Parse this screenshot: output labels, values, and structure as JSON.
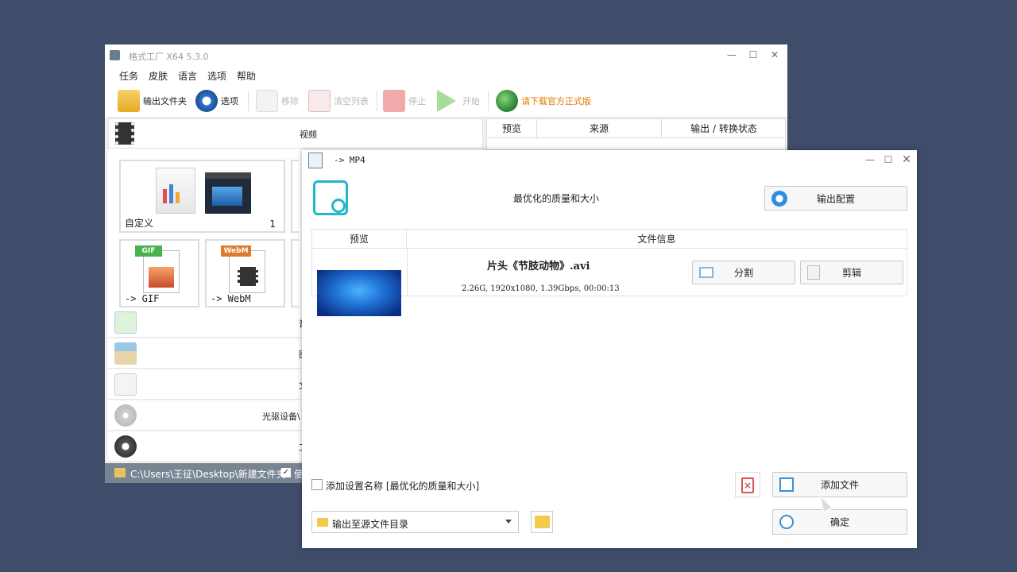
{
  "main_window": {
    "title": "格式工厂 X64 5.3.0",
    "controls": {
      "minimize": "—",
      "maximize": "☐",
      "close": "✕"
    },
    "menu": [
      "任务",
      "皮肤",
      "语言",
      "选项",
      "帮助"
    ],
    "toolbar": {
      "output_folder": "输出文件夹",
      "options": "选项",
      "remove": "移除",
      "clear_list": "清空列表",
      "stop": "停止",
      "start": "开始",
      "download": "请下载官方正式版"
    },
    "category_video": "视频",
    "tiles": [
      {
        "label": "自定义",
        "count": "1"
      },
      {
        "label": "-> GIF"
      },
      {
        "label": "-> WebM"
      }
    ],
    "tile_badges": {
      "gif": "GIF",
      "webm": "WebM"
    },
    "categories": [
      "音",
      "图",
      "文",
      "光驱设备\\",
      "工"
    ],
    "task_table_headers": [
      "预览",
      "来源",
      "输出 / 转换状态"
    ],
    "statusbar": {
      "path": "C:\\Users\\王征\\Desktop\\新建文件夹",
      "checkbox": "✓",
      "more": "使"
    }
  },
  "dialog": {
    "title": "-> MP4",
    "controls": {
      "minimize": "—",
      "maximize": "☐",
      "close": "✕"
    },
    "quality_label": "最优化的质量和大小",
    "output_config_button": "输出配置",
    "table_headers": {
      "preview": "预览",
      "file_info": "文件信息"
    },
    "file": {
      "name": "片头《节肢动物》.avi",
      "info": "2.26G, 1920x1080, 1.39Gbps, 00:00:13"
    },
    "split_button": "分割",
    "edit_button": "剪辑",
    "add_setting_name": "添加设置名称 [最优化的质量和大小]",
    "add_file_button": "添加文件",
    "output_dir": "输出至源文件目录",
    "ok_button": "确定"
  },
  "colors": {
    "background": "#3f4d6b",
    "accent": "#1fb8c6",
    "download_text": "#e07b00"
  }
}
